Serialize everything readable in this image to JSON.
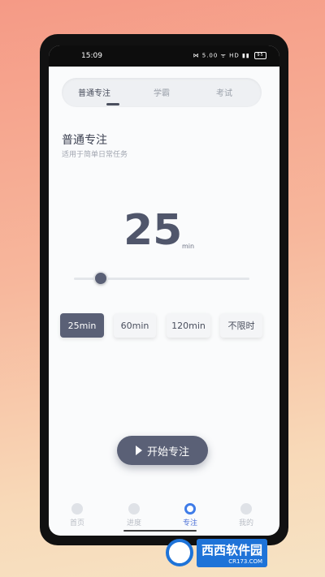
{
  "status_bar": {
    "time": "15:09",
    "icons": "⋈ 5.00 ᯤ HD ▮▮",
    "battery": "95"
  },
  "tabs": [
    {
      "label": "普通专注"
    },
    {
      "label": "学霸"
    },
    {
      "label": "考试"
    }
  ],
  "mode": {
    "title": "普通专注",
    "subtitle": "适用于简单日常任务"
  },
  "timer": {
    "value": "25",
    "unit": "min"
  },
  "slider": {
    "level": 0.13
  },
  "durations": [
    {
      "label": "25min"
    },
    {
      "label": "60min"
    },
    {
      "label": "120min"
    },
    {
      "label": "不限时"
    }
  ],
  "start_button": {
    "label": "开始专注",
    "icon": "play-icon"
  },
  "bottom_nav": [
    {
      "label": "首页",
      "icon": "home-icon"
    },
    {
      "label": "进度",
      "icon": "progress-icon"
    },
    {
      "label": "专注",
      "icon": "focus-icon"
    },
    {
      "label": "我的",
      "icon": "profile-icon"
    }
  ],
  "watermark": {
    "brand": "西西软件园",
    "url": "CR173.COM"
  },
  "colors": {
    "accent": "#5a6076",
    "nav_active": "#4a6fd6"
  }
}
